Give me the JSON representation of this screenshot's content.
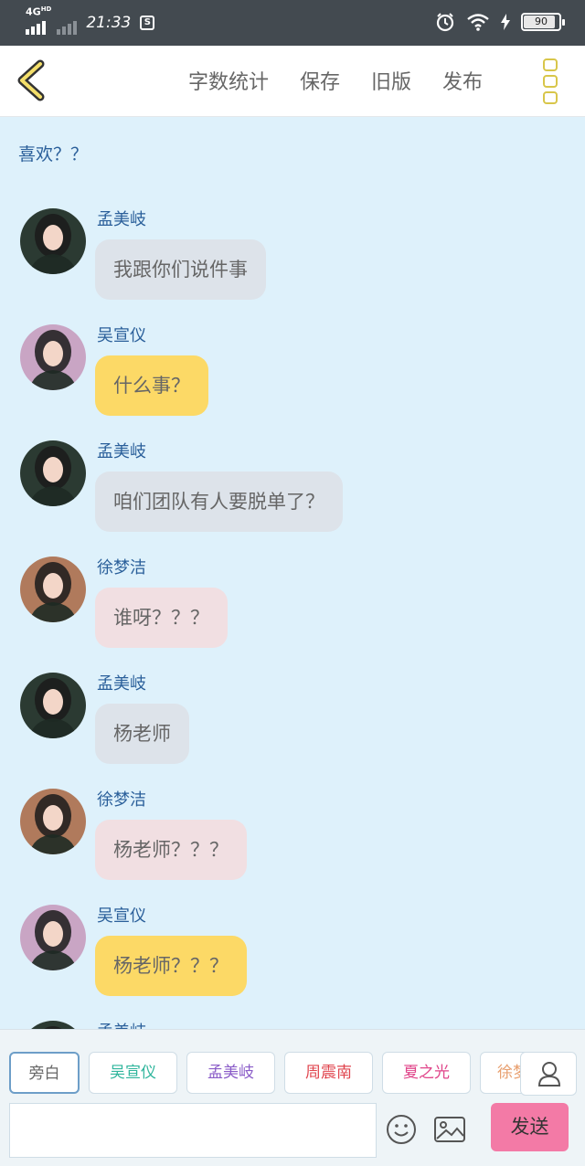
{
  "status_bar": {
    "network": "4G",
    "network_sup": "HD",
    "time": "21:33",
    "battery": "90",
    "icons": [
      "signal-icon",
      "alarm-icon",
      "wifi-icon",
      "charging-icon",
      "battery-icon"
    ]
  },
  "header": {
    "actions": [
      "字数统计",
      "保存",
      "旧版",
      "发布"
    ]
  },
  "chat": {
    "narration": "喜欢？？",
    "messages": [
      {
        "sender": "孟美岐",
        "text": "我跟你们说件事",
        "bubble_color": "#dde3ea",
        "avatar_color": "#2b3a32"
      },
      {
        "sender": "吴宣仪",
        "text": "什么事？",
        "bubble_color": "#fcd966",
        "avatar_color": "#c9a5c4"
      },
      {
        "sender": "孟美岐",
        "text": "咱们团队有人要脱单了？",
        "bubble_color": "#dde3ea",
        "avatar_color": "#2b3a32"
      },
      {
        "sender": "徐梦洁",
        "text": "谁呀？？？",
        "bubble_color": "#f1dfe2",
        "avatar_color": "#b07a5c"
      },
      {
        "sender": "孟美岐",
        "text": "杨老师",
        "bubble_color": "#dde3ea",
        "avatar_color": "#2b3a32"
      },
      {
        "sender": "徐梦洁",
        "text": "杨老师？？？",
        "bubble_color": "#f1dfe2",
        "avatar_color": "#b07a5c"
      },
      {
        "sender": "吴宣仪",
        "text": "杨老师？？？",
        "bubble_color": "#fcd966",
        "avatar_color": "#c9a5c4"
      },
      {
        "sender": "孟美岐",
        "text": "",
        "bubble_color": "#dde3ea",
        "avatar_color": "#2b3a32"
      }
    ]
  },
  "characters": [
    {
      "label": "旁白",
      "color": "#666666"
    },
    {
      "label": "吴宣仪",
      "color": "#2fb59c"
    },
    {
      "label": "孟美岐",
      "color": "#8a5cc8"
    },
    {
      "label": "周震南",
      "color": "#e0464f"
    },
    {
      "label": "夏之光",
      "color": "#e0458a"
    },
    {
      "label": "徐梦",
      "color": "#e8a070"
    }
  ],
  "input": {
    "placeholder": "",
    "send_label": "发送"
  }
}
